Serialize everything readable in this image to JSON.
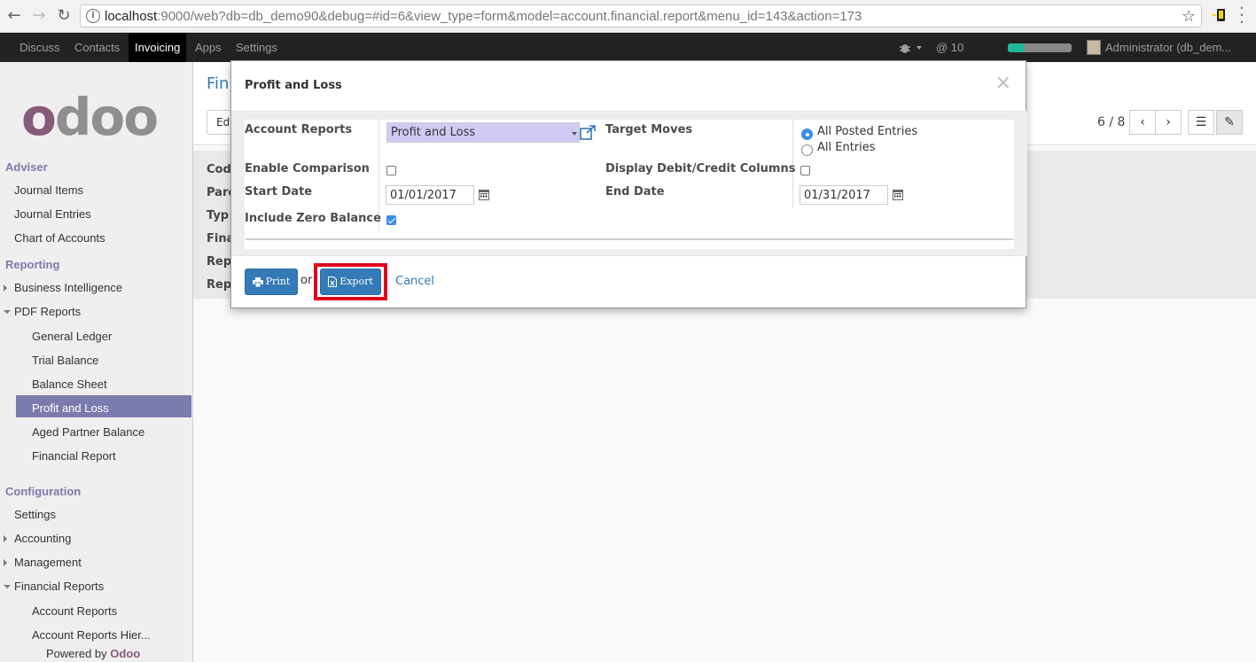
{
  "browser": {
    "url_host": "localhost",
    "url_rest": ":9000/web?db=db_demo90&debug=#id=6&view_type=form&model=account.financial.report&menu_id=143&action=173"
  },
  "topnav": {
    "menus": [
      "Discuss",
      "Contacts",
      "Invoicing",
      "Apps",
      "Settings"
    ],
    "active_menu": "Invoicing",
    "messages_count": "@ 10",
    "progress_percent": 25,
    "user": "Administrator (db_dem..."
  },
  "sidebar": {
    "logo": "odoo",
    "sections": [
      {
        "title": "Adviser",
        "items": [
          "Journal Items",
          "Journal Entries",
          "Chart of Accounts"
        ]
      },
      {
        "title": "Reporting",
        "items": [
          "Business Intelligence",
          "PDF Reports",
          "General Ledger",
          "Trial Balance",
          "Balance Sheet",
          "Profit and Loss",
          "Aged Partner Balance",
          "Financial Report"
        ]
      },
      {
        "title": "Configuration",
        "items": [
          "Settings",
          "Accounting",
          "Management",
          "Financial Reports",
          "Account Reports",
          "Account Reports Hier..."
        ]
      }
    ],
    "active_item": "Profit and Loss",
    "powered_by": "Powered by",
    "powered_brand": "Odoo"
  },
  "background": {
    "title": "Fin",
    "edit_label": "Edi",
    "pager": "6 / 8",
    "labels": [
      "Cod",
      "Pare",
      "Typ",
      "Fina",
      "Rep",
      "Rep"
    ]
  },
  "modal": {
    "title": "Profit and Loss",
    "close": "×",
    "fields": {
      "account_reports_label": "Account Reports",
      "account_reports_value": "Profit and Loss",
      "target_moves_label": "Target Moves",
      "target_moves_options": [
        "All Posted Entries",
        "All Entries"
      ],
      "target_moves_selected": "All Posted Entries",
      "enable_comparison_label": "Enable Comparison",
      "enable_comparison_checked": false,
      "display_debit_credit_label": "Display Debit/Credit Columns",
      "display_debit_credit_checked": false,
      "start_date_label": "Start Date",
      "start_date_value": "01/01/2017",
      "end_date_label": "End Date",
      "end_date_value": "01/31/2017",
      "include_zero_balance_label": "Include Zero Balance",
      "include_zero_balance_checked": true
    },
    "footer": {
      "print_label": "Print",
      "or_label": "or",
      "export_label": "Export",
      "cancel_label": "Cancel"
    }
  },
  "colors": {
    "brand": "#875a7b",
    "sidebar_active": "#7c7bad",
    "primary_button": "#337ab7",
    "highlight": "#e0001b"
  }
}
